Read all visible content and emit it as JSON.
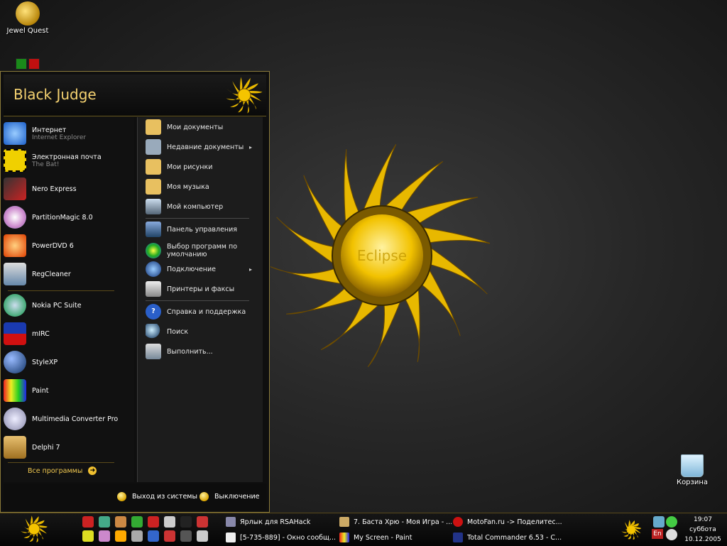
{
  "desktop": {
    "icons": [
      {
        "label": "Jewel Quest"
      },
      {
        "label": "Корзина"
      }
    ],
    "wallpaper_text": "Eclipse"
  },
  "start_menu": {
    "user": "Black Judge",
    "pinned": [
      {
        "title": "Интернет",
        "subtitle": "Internet Explorer",
        "icon": "ie-icon"
      },
      {
        "title": "Электронная почта",
        "subtitle": "The Bat!",
        "icon": "the-bat-icon"
      }
    ],
    "recent": [
      {
        "title": "Nero Express",
        "icon": "nero-icon"
      },
      {
        "title": "PartitionMagic 8.0",
        "icon": "partitionmagic-icon"
      },
      {
        "title": "PowerDVD 6",
        "icon": "powerdvd-icon"
      },
      {
        "title": "RegCleaner",
        "icon": "regcleaner-icon"
      },
      {
        "title": "Nokia PC Suite",
        "icon": "nokia-icon"
      },
      {
        "title": "mIRC",
        "icon": "mirc-icon"
      },
      {
        "title": "StyleXP",
        "icon": "stylexp-icon"
      },
      {
        "title": "Paint",
        "icon": "paint-icon"
      },
      {
        "title": "Multimedia Converter Pro",
        "icon": "converter-icon"
      },
      {
        "title": "Delphi 7",
        "icon": "delphi-icon"
      }
    ],
    "all_programs": "Все программы",
    "places": [
      {
        "label": "Мои документы",
        "submenu": false
      },
      {
        "label": "Недавние документы",
        "submenu": true
      },
      {
        "label": "Мои рисунки",
        "submenu": false
      },
      {
        "label": "Моя музыка",
        "submenu": false
      },
      {
        "label": "Мой компьютер",
        "submenu": false
      },
      {
        "label": "Панель управления",
        "submenu": false
      },
      {
        "label": "Выбор программ по умолчанию",
        "submenu": false
      },
      {
        "label": "Подключение",
        "submenu": true
      },
      {
        "label": "Принтеры и факсы",
        "submenu": false
      },
      {
        "label": "Справка и поддержка",
        "submenu": false
      },
      {
        "label": "Поиск",
        "submenu": false
      },
      {
        "label": "Выполнить...",
        "submenu": false
      }
    ],
    "logoff": "Выход из системы",
    "shutdown": "Выключение"
  },
  "taskbar": {
    "tasks": [
      {
        "label": "Ярлык для RSAHack"
      },
      {
        "label": "7. Баста Хрю - Моя Игра - ..."
      },
      {
        "label": "MotoFan.ru -> Поделитес..."
      },
      {
        "label": "[5-735-889] - Окно сообщ..."
      },
      {
        "label": "My Screen - Paint"
      },
      {
        "label": "Total Commander 6.53 - C..."
      }
    ],
    "lang": "En",
    "clock": {
      "time": "19:07",
      "day": "суббота",
      "date": "10.12.2005"
    }
  },
  "colors": {
    "accent": "#f5d271",
    "border": "#8a7a3a",
    "sun": "#f2c200"
  }
}
